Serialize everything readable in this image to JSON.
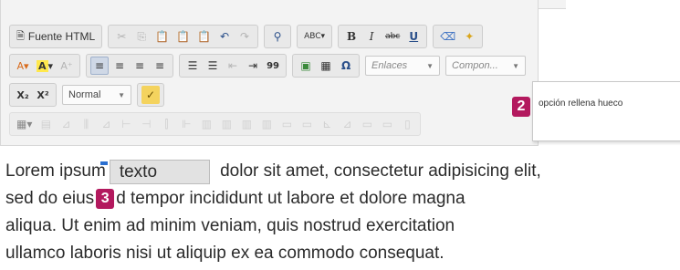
{
  "toolbar": {
    "row1": {
      "source_label": "Fuente HTML",
      "bold": "B",
      "italic": "I",
      "strike": "abc",
      "underline": "U",
      "spellcheck": "ABC"
    },
    "row2": {
      "text_color": "A",
      "bg_color": "A",
      "quote": "99",
      "special_char": "Ω",
      "links_combo": "Enlaces",
      "components_combo": "Compon..."
    },
    "row3": {
      "subscript": "X₂",
      "superscript": "X²",
      "format_combo": "Normal"
    }
  },
  "tooltip": {
    "badge": "2",
    "text": "opción rellena hueco"
  },
  "content": {
    "line1_before": "Lorem ipsu",
    "line1_partial": "m",
    "blank_value": "texto",
    "line1_after": "dolor sit amet, consectetur adipisicing elit,",
    "line2_before": "sed do eius",
    "badge": "3",
    "line2_after": "d tempor incididunt ut labore et dolore magna",
    "line3": "aliqua. Ut enim ad minim veniam, quis nostrud exercitation",
    "line4": "ullamco laboris nisi ut aliquip ex ea commodo consequat."
  },
  "colors": {
    "badge": "#b3195e",
    "toolbar_bg": "#f3f3f3",
    "blank_bg": "#e2e2e2"
  }
}
